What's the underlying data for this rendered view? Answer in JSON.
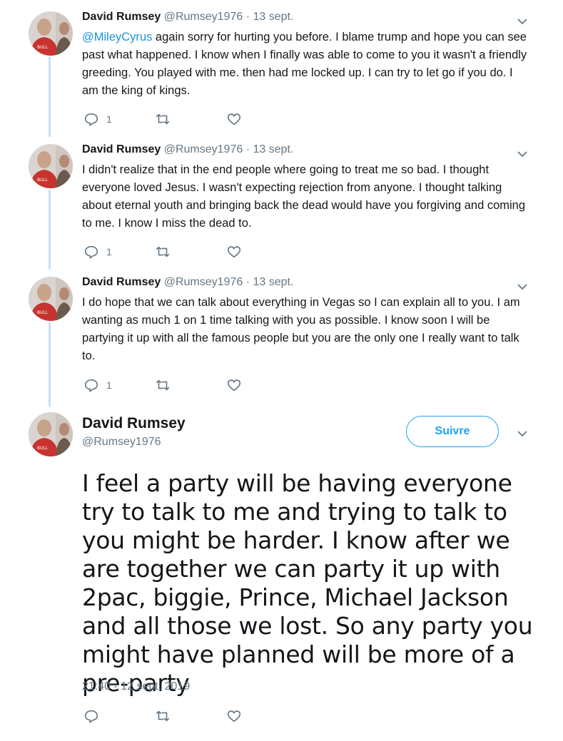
{
  "replies": [
    {
      "name": "David Rumsey",
      "handle": "@Rumsey1976",
      "separator": "·",
      "date": "13 sept.",
      "mention": "@MileyCyrus",
      "text": " again sorry for hurting you before. I blame trump and hope you can see past what happened. I know when I finally was able to come to you it wasn't a friendly greeding. You played with me. then had me locked up. I can try to let go if you do. I am the king of kings.",
      "reply_count": "1"
    },
    {
      "name": "David Rumsey",
      "handle": "@Rumsey1976",
      "separator": "·",
      "date": "13 sept.",
      "mention": "",
      "text": "I didn't realize that in the end people where going to treat me so bad. I thought everyone loved Jesus. I wasn't expecting rejection from anyone. I thought talking about eternal youth and bringing back the dead would have you forgiving and coming to me. I know I miss the dead to.",
      "reply_count": "1"
    },
    {
      "name": "David Rumsey",
      "handle": "@Rumsey1976",
      "separator": "·",
      "date": "13 sept.",
      "mention": "",
      "text": "I do hope that we can talk about everything in Vegas so I can explain all to you. I am wanting as much 1 on 1 time talking with you as possible. I know soon I will be partying it up with all the famous people but you are the only one I really want to talk to.",
      "reply_count": "1"
    }
  ],
  "main_tweet": {
    "name": "David Rumsey",
    "handle": "@Rumsey1976",
    "follow_label": "Suivre",
    "text": "I feel a party will be having everyone try to talk to me and trying to talk to you might be harder. I know after we are together we can party it up with 2pac, biggie, Prince, Michael Jackson and all those we lost. So any party you might have planned will be more of a pre-party",
    "timestamp": "21:40 - 12 sept. 2019"
  },
  "icons": {
    "reply": "reply-icon",
    "retweet": "retweet-icon",
    "like": "heart-icon",
    "more": "chevron-down-icon"
  },
  "colors": {
    "accent": "#1da1f2",
    "mention": "#1b95e0",
    "muted": "#657786",
    "thread_line": "#c4e2f6"
  }
}
